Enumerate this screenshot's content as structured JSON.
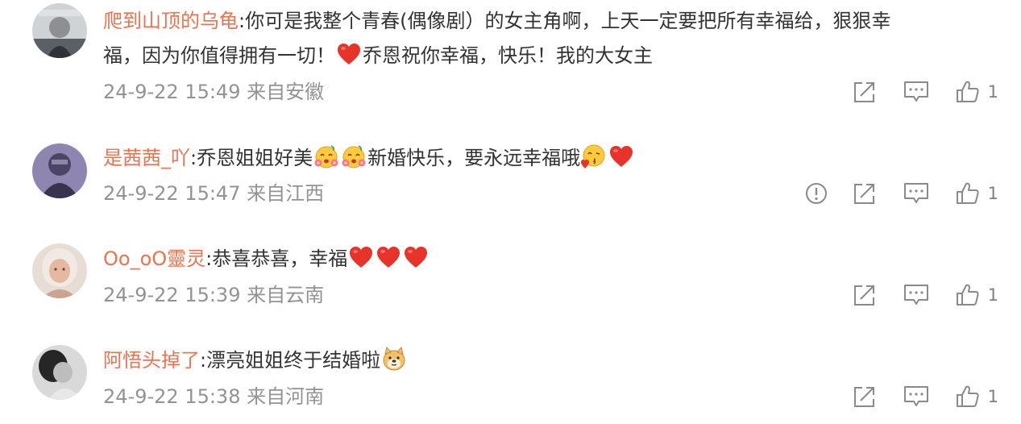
{
  "comments": [
    {
      "user": "爬到山顶的乌龟",
      "line1": ":你可是我整个青春(偶像剧）的女主角啊，上天一定要把所有幸福给，狠狠幸",
      "line2_pre": "福，因为你值得拥有一切！",
      "line2_post": "乔恩祝你幸福，快乐！我的大女主",
      "meta": "24-9-22 15:49 来自安徽",
      "likes": "1",
      "icons": [
        "share-icon",
        "comment-icon",
        "like-icon"
      ]
    },
    {
      "user": "是茜茜_吖",
      "text_a": ":乔恩姐姐好美",
      "text_b": "新婚快乐，要永远幸福哦",
      "meta": "24-9-22 15:47 来自江西",
      "likes": "1",
      "icons": [
        "report-icon",
        "share-icon",
        "comment-icon",
        "like-icon"
      ]
    },
    {
      "user": "Oo_oO靈灵",
      "text": ":恭喜恭喜，幸福",
      "meta": "24-9-22 15:39 来自云南",
      "likes": "1",
      "icons": [
        "share-icon",
        "comment-icon",
        "like-icon"
      ]
    },
    {
      "user": "阿悟头掉了",
      "text": ":漂亮姐姐终于结婚啦",
      "meta": "24-9-22 15:38 来自河南",
      "likes": "1",
      "icons": [
        "share-icon",
        "comment-icon",
        "like-icon"
      ]
    }
  ],
  "colors": {
    "username": "#eb7350",
    "meta": "#939393",
    "icon": "#8a8a8a",
    "heart": "#e8332a"
  }
}
